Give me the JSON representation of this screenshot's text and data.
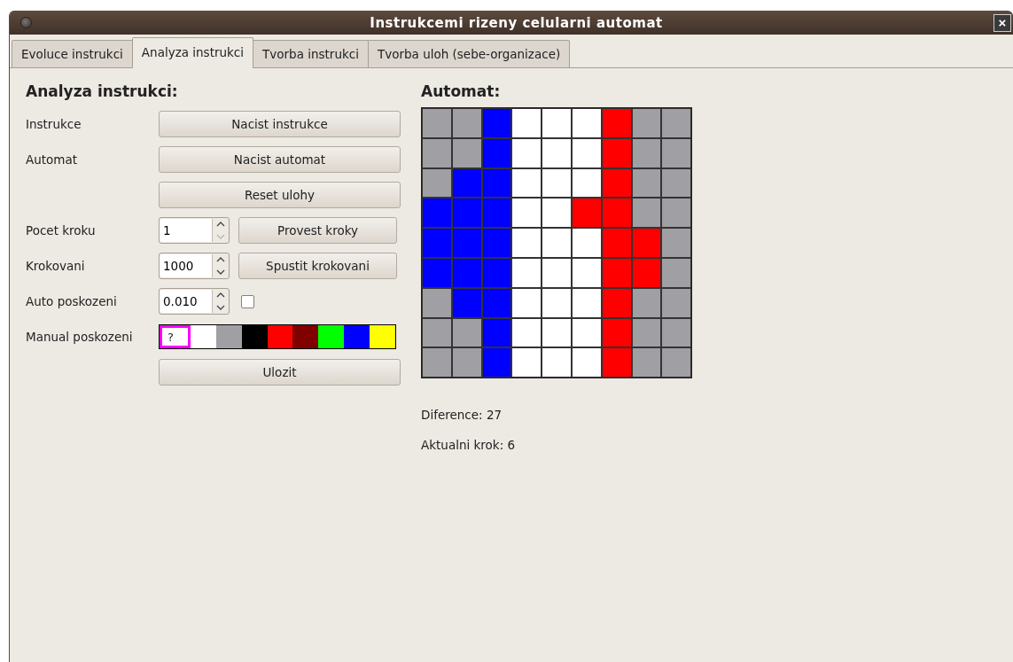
{
  "window": {
    "title": "Instrukcemi rizeny celularni automat",
    "close": "×"
  },
  "tabs": [
    {
      "label": "Evoluce instrukci",
      "selected": false
    },
    {
      "label": "Analyza instrukci",
      "selected": true
    },
    {
      "label": "Tvorba instrukci",
      "selected": false
    },
    {
      "label": "Tvorba uloh (sebe-organizace)",
      "selected": false
    }
  ],
  "panel": {
    "heading": "Analyza instrukci:",
    "rows": [
      {
        "kind": "button",
        "label": "Instrukce",
        "button": "Nacist instrukce"
      },
      {
        "kind": "button",
        "label": "Automat",
        "button": "Nacist automat"
      },
      {
        "kind": "button",
        "button": "Reset ulohy"
      },
      {
        "kind": "spin",
        "label": "Pocet kroku",
        "value": "1",
        "down_disabled": true,
        "button": "Provest kroky"
      },
      {
        "kind": "spin",
        "label": "Krokovani",
        "value": "1000",
        "down_disabled": false,
        "button": "Spustit krokovani"
      },
      {
        "kind": "spincheck",
        "label": "Auto poskozeni",
        "value": "0.010",
        "down_disabled": false,
        "checked": false
      },
      {
        "kind": "palette",
        "label": "Manual poskozeni",
        "swatches": [
          {
            "kind": "unknown",
            "text": "?",
            "selected": true
          },
          {
            "kind": "color",
            "color": "#ffffff",
            "selected": false
          },
          {
            "kind": "color",
            "color": "#a0a0a4",
            "selected": false
          },
          {
            "kind": "color",
            "color": "#000000",
            "selected": false
          },
          {
            "kind": "color",
            "color": "#ff0000",
            "selected": false
          },
          {
            "kind": "color",
            "color": "#800000",
            "selected": false
          },
          {
            "kind": "color",
            "color": "#00ff00",
            "selected": false
          },
          {
            "kind": "color",
            "color": "#0000ff",
            "selected": false
          },
          {
            "kind": "color",
            "color": "#ffff00",
            "selected": false
          }
        ]
      },
      {
        "kind": "button",
        "button": "Ulozit"
      }
    ]
  },
  "automat": {
    "heading": "Automat:",
    "cells": [
      [
        {
          "color": "#a0a0a4"
        },
        {
          "color": "#a0a0a4"
        },
        {
          "color": "#0000ff"
        },
        {
          "color": "#ffffff"
        },
        {
          "color": "#ffffff"
        },
        {
          "color": "#ffffff"
        },
        {
          "color": "#ff0000"
        },
        {
          "color": "#a0a0a4"
        },
        {
          "color": "#a0a0a4"
        }
      ],
      [
        {
          "color": "#a0a0a4"
        },
        {
          "color": "#a0a0a4"
        },
        {
          "color": "#0000ff"
        },
        {
          "color": "#ffffff"
        },
        {
          "color": "#ffffff"
        },
        {
          "color": "#ffffff"
        },
        {
          "color": "#ff0000"
        },
        {
          "color": "#a0a0a4"
        },
        {
          "color": "#a0a0a4"
        }
      ],
      [
        {
          "color": "#a0a0a4"
        },
        {
          "color": "#0000ff"
        },
        {
          "color": "#0000ff"
        },
        {
          "color": "#ffffff"
        },
        {
          "color": "#ffffff"
        },
        {
          "color": "#ffffff"
        },
        {
          "color": "#ff0000"
        },
        {
          "color": "#a0a0a4"
        },
        {
          "color": "#a0a0a4"
        }
      ],
      [
        {
          "color": "#0000ff"
        },
        {
          "color": "#0000ff"
        },
        {
          "color": "#0000ff"
        },
        {
          "color": "#ffffff"
        },
        {
          "color": "#ffffff"
        },
        {
          "color": "#ff0000"
        },
        {
          "color": "#ff0000"
        },
        {
          "color": "#a0a0a4"
        },
        {
          "color": "#a0a0a4"
        }
      ],
      [
        {
          "color": "#0000ff"
        },
        {
          "color": "#0000ff"
        },
        {
          "color": "#0000ff"
        },
        {
          "color": "#ffffff"
        },
        {
          "color": "#ffffff"
        },
        {
          "color": "#ffffff"
        },
        {
          "color": "#ff0000"
        },
        {
          "color": "#ff0000"
        },
        {
          "color": "#a0a0a4"
        }
      ],
      [
        {
          "color": "#0000ff"
        },
        {
          "color": "#0000ff"
        },
        {
          "color": "#0000ff"
        },
        {
          "color": "#ffffff"
        },
        {
          "color": "#ffffff"
        },
        {
          "color": "#ffffff"
        },
        {
          "color": "#ff0000"
        },
        {
          "color": "#ff0000"
        },
        {
          "color": "#a0a0a4"
        }
      ],
      [
        {
          "color": "#a0a0a4"
        },
        {
          "color": "#0000ff"
        },
        {
          "color": "#0000ff"
        },
        {
          "color": "#ffffff"
        },
        {
          "color": "#ffffff"
        },
        {
          "color": "#ffffff"
        },
        {
          "color": "#ff0000"
        },
        {
          "color": "#a0a0a4"
        },
        {
          "color": "#a0a0a4"
        }
      ],
      [
        {
          "color": "#a0a0a4"
        },
        {
          "color": "#a0a0a4"
        },
        {
          "color": "#0000ff"
        },
        {
          "color": "#ffffff"
        },
        {
          "color": "#ffffff"
        },
        {
          "color": "#ffffff"
        },
        {
          "color": "#ff0000"
        },
        {
          "color": "#a0a0a4"
        },
        {
          "color": "#a0a0a4"
        }
      ],
      [
        {
          "color": "#a0a0a4"
        },
        {
          "color": "#a0a0a4"
        },
        {
          "color": "#0000ff"
        },
        {
          "color": "#ffffff"
        },
        {
          "color": "#ffffff"
        },
        {
          "color": "#ffffff"
        },
        {
          "color": "#ff0000"
        },
        {
          "color": "#a0a0a4"
        },
        {
          "color": "#a0a0a4"
        }
      ]
    ],
    "diference": "Diference: 27",
    "step": "Aktualni krok: 6"
  }
}
